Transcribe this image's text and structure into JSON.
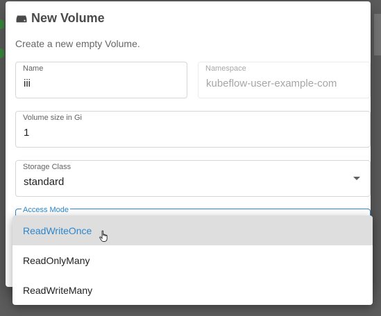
{
  "dialog": {
    "title": "New Volume",
    "title_icon": "storage-drive-icon",
    "subtitle": "Create a new empty Volume."
  },
  "fields": {
    "name": {
      "label": "Name",
      "value": "iii"
    },
    "namespace": {
      "label": "Namespace",
      "value": "kubeflow-user-example-com"
    },
    "size": {
      "label": "Volume size in Gi",
      "value": "1"
    },
    "storage_class": {
      "label": "Storage Class",
      "value": "standard"
    },
    "access_mode": {
      "label": "Access Mode"
    }
  },
  "access_mode_options": [
    {
      "label": "ReadWriteOnce",
      "highlighted": true
    },
    {
      "label": "ReadOnlyMany",
      "highlighted": false
    },
    {
      "label": "ReadWriteMany",
      "highlighted": false
    }
  ],
  "colors": {
    "accent": "#2e86c9",
    "highlight_bg": "#dedede",
    "backdrop": "#5c5c5c"
  }
}
